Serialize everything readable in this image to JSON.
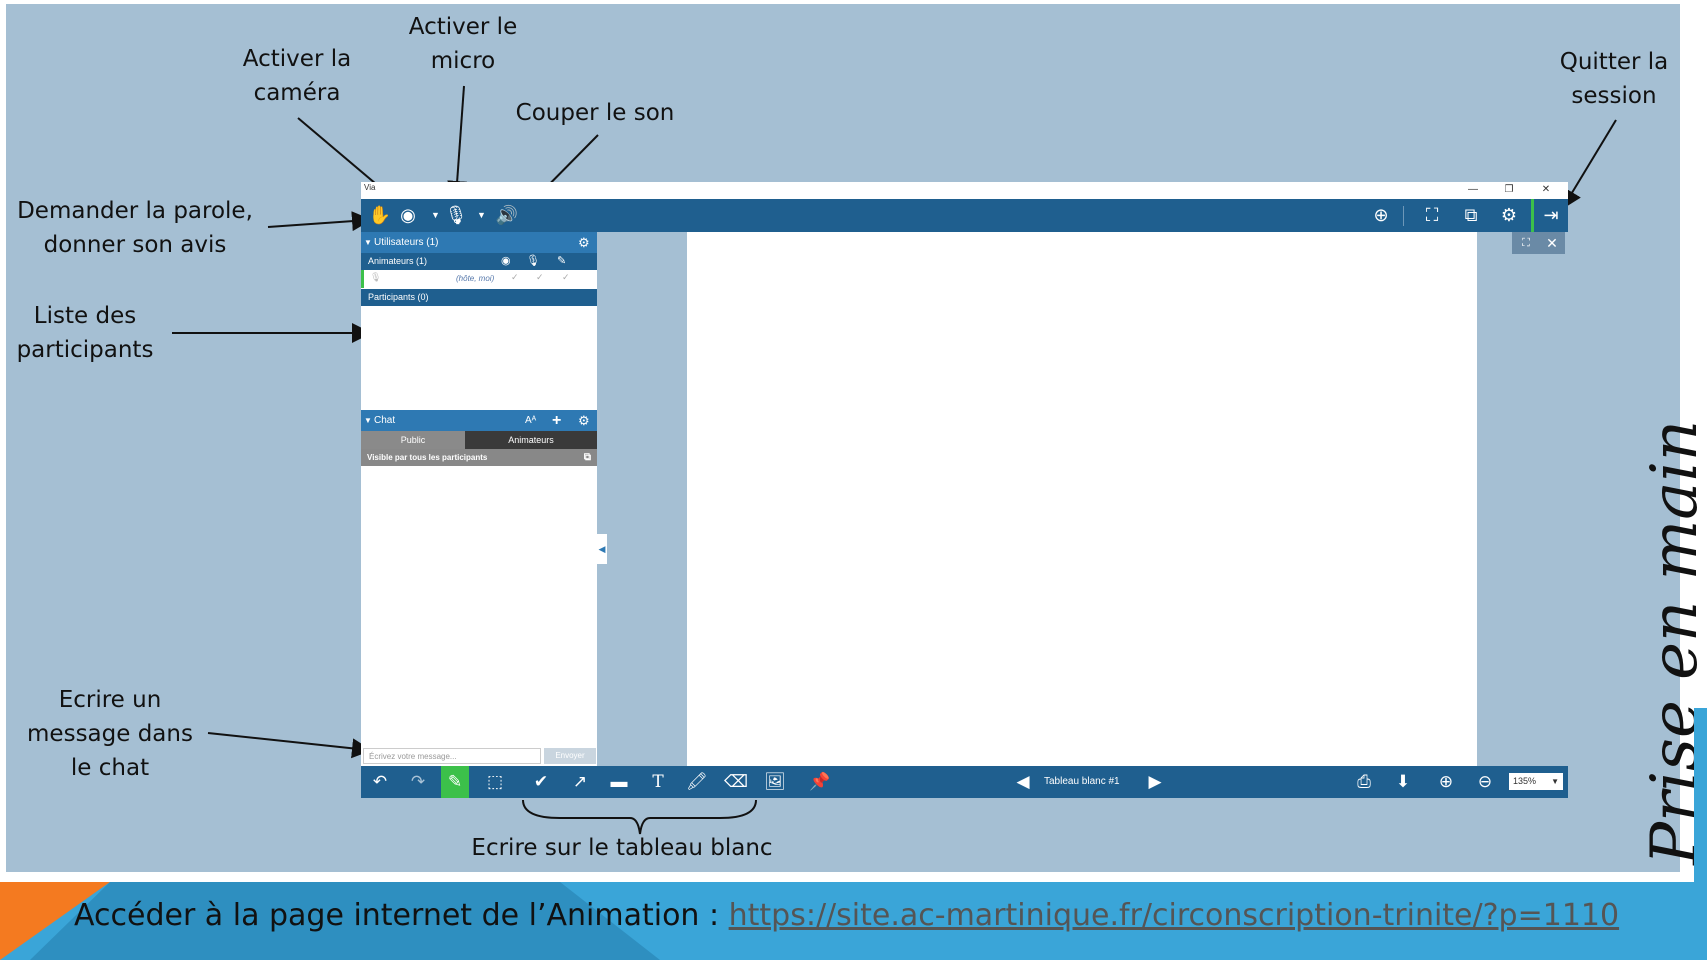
{
  "annotations": {
    "camera": "Activer la\ncaméra",
    "micro": "Activer le\nmicro",
    "mute": "Couper le son",
    "quit": "Quitter la\nsession",
    "hand": "Demander la parole,\ndonner son avis",
    "participants": "Liste des\nparticipants",
    "chat_message": "Ecrire un\nmessage dans\nle chat",
    "whiteboard": "Ecrire sur le tableau blanc"
  },
  "app": {
    "window_title": "Via",
    "window_controls": {
      "minimize": "—",
      "restore": "❐",
      "close": "✕"
    },
    "toolbar_icons": [
      "hand-icon",
      "webcam-icon",
      "microphone-icon",
      "speaker-icon",
      "globe-icon",
      "network-icon",
      "share-icon",
      "gear-icon",
      "exit-icon"
    ],
    "users_panel": {
      "header": "Utilisateurs (1)",
      "animators_header": "Animateurs (1)",
      "host_label": "(hôte, moi)",
      "participants_header": "Participants (0)"
    },
    "chat": {
      "header": "Chat",
      "font_label": "Aᴬ",
      "tabs": [
        "Public",
        "Animateurs"
      ],
      "visibility": "Visible par tous les participants",
      "input_placeholder": "Écrivez votre message...",
      "send_label": "Envoyer"
    },
    "whiteboard": {
      "board_label": "Tableau blanc #1",
      "zoom": "135%"
    }
  },
  "vertical_title": "Prise en main",
  "footer": {
    "text": "Accéder à la page internet de l’Animation : ",
    "link": "https://site.ac-martinique.fr/circonscription-trinite/?p=1110"
  },
  "colors": {
    "slide_bg": "#a5bfd3",
    "app_bar": "#1f5f8f",
    "panel_header": "#2e79b3",
    "active_green": "#3cc04a",
    "footer_blue": "#3aa5d8",
    "footer_orange": "#f47a20"
  }
}
